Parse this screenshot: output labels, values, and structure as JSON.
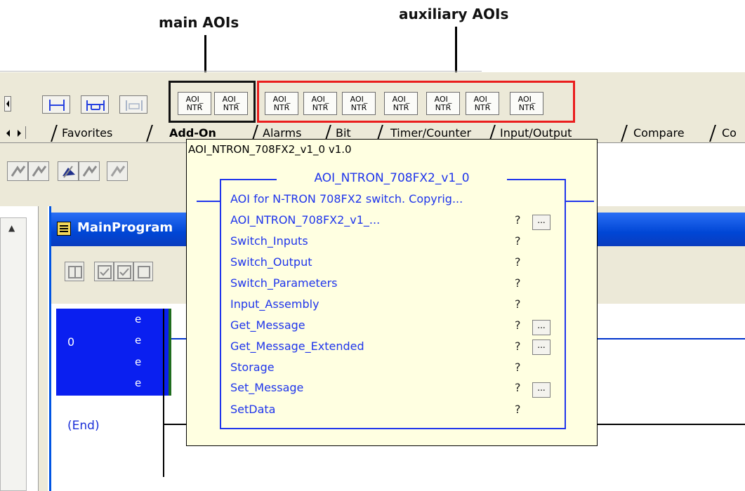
{
  "annotations": {
    "main_label": "main AOIs",
    "aux_label": "auxiliary AOIs",
    "main_box_color": "#111111",
    "aux_box_color": "#ea1d1d"
  },
  "toolbar": {
    "element_icons": [
      "rung-icon",
      "branch-icon",
      "branch-level-icon"
    ],
    "aoi_buttons": [
      {
        "line1": "AOI_",
        "line2": "NTR"
      },
      {
        "line1": "AOI_",
        "line2": "NTR"
      },
      {
        "line1": "AOI_",
        "line2": "NTR"
      },
      {
        "line1": "AOI_",
        "line2": "NTR"
      },
      {
        "line1": "AOI_",
        "line2": "NTR"
      },
      {
        "line1": "AOI_",
        "line2": "NTR"
      },
      {
        "line1": "AOI_",
        "line2": "NTR"
      },
      {
        "line1": "AOI_",
        "line2": "NTR"
      },
      {
        "line1": "AOI_",
        "line2": "NTR"
      }
    ]
  },
  "tabs": [
    {
      "label": "Favorites",
      "active": false
    },
    {
      "label": "Add-On",
      "active": true
    },
    {
      "label": "Alarms",
      "active": false
    },
    {
      "label": "Bit",
      "active": false
    },
    {
      "label": "Timer/Counter",
      "active": false
    },
    {
      "label": "Input/Output",
      "active": false
    },
    {
      "label": "Compare",
      "active": false
    },
    {
      "label": "Co",
      "active": false
    }
  ],
  "routine": {
    "title": "MainProgram",
    "rung_number": "0",
    "error_marks": [
      "e",
      "e",
      "e",
      "e"
    ],
    "end_label": "(End)",
    "selection_color": "#0a1ff0"
  },
  "tooltip": {
    "header": "AOI_NTRON_708FX2_v1_0 v1.0",
    "block_name": "AOI_NTRON_708FX2_v1_0",
    "description": "AOI for N-TRON 708FX2 switch. Copyrig...",
    "params": [
      {
        "name": "AOI_NTRON_708FX2_v1_...",
        "value": "?",
        "browse": "..."
      },
      {
        "name": "Switch_Inputs",
        "value": "?",
        "browse": ""
      },
      {
        "name": "Switch_Output",
        "value": "?",
        "browse": ""
      },
      {
        "name": "Switch_Parameters",
        "value": "?",
        "browse": ""
      },
      {
        "name": "Input_Assembly",
        "value": "?",
        "browse": ""
      },
      {
        "name": "Get_Message",
        "value": "?",
        "browse": "..."
      },
      {
        "name": "Get_Message_Extended",
        "value": "?",
        "browse": "..."
      },
      {
        "name": "Storage",
        "value": "?",
        "browse": ""
      },
      {
        "name": "Set_Message",
        "value": "?",
        "browse": "..."
      },
      {
        "name": "SetData",
        "value": "?",
        "browse": ""
      }
    ],
    "background_color": "#ffffe1",
    "block_color": "#1f35ec"
  }
}
